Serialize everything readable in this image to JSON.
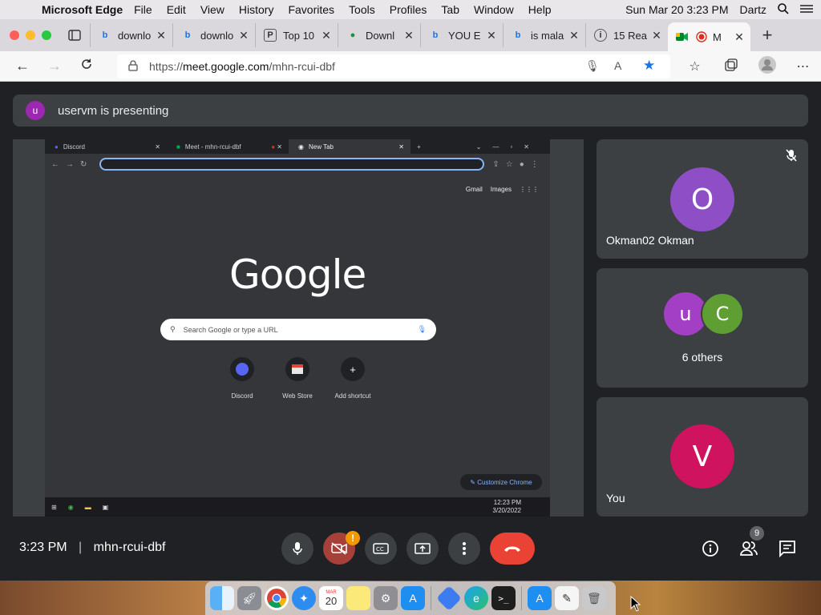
{
  "menubar": {
    "app_name": "Microsoft Edge",
    "menus": [
      "File",
      "Edit",
      "View",
      "History",
      "Favorites",
      "Tools",
      "Profiles",
      "Tab",
      "Window",
      "Help"
    ],
    "clock": "Sun Mar 20  3:23 PM",
    "user": "Dartz"
  },
  "tabs": [
    {
      "title": "downlo",
      "favicon": "bing-icon"
    },
    {
      "title": "downlo",
      "favicon": "bing-icon"
    },
    {
      "title": "Top 10",
      "favicon": "page-icon"
    },
    {
      "title": "Downl",
      "favicon": "download-site-icon"
    },
    {
      "title": "YOU E",
      "favicon": "bing-icon"
    },
    {
      "title": "is mala",
      "favicon": "bing-icon"
    },
    {
      "title": "15 Rea",
      "favicon": "page-icon"
    },
    {
      "title": "M",
      "favicon": "meet-icon",
      "active": true
    }
  ],
  "address": {
    "scheme": "https://",
    "host": "meet.google.com",
    "path": "/mhn-rcui-dbf"
  },
  "banner": {
    "avatar_letter": "u",
    "text": "uservm is presenting"
  },
  "shared_screen": {
    "tabs": [
      "Discord",
      "Meet - mhn-rcui-dbf",
      "New Tab"
    ],
    "links": [
      "Gmail",
      "Images"
    ],
    "logo": "Google",
    "search_placeholder": "Search Google or type a URL",
    "shortcuts": [
      "Discord",
      "Web Store",
      "Add shortcut"
    ],
    "customize": "Customize Chrome",
    "taskbar_time": "12:23 PM",
    "taskbar_date": "3/20/2022"
  },
  "participants": [
    {
      "letter": "O",
      "name": "Okman02 Okman",
      "color": "#8e4ec6",
      "muted": true
    },
    {
      "letters": [
        "u",
        "C"
      ],
      "name": "6 others",
      "colors": [
        "#a23fc4",
        "#5f9e33"
      ]
    },
    {
      "letter": "V",
      "name": "You",
      "color": "#d0135f"
    }
  ],
  "controls": {
    "time": "3:23 PM",
    "separator": "|",
    "meeting_code": "mhn-rcui-dbf",
    "camera_alert": "!",
    "people_count": "9"
  },
  "dock": [
    "finder-icon",
    "launchpad-icon",
    "chrome-icon",
    "safari-icon",
    "calendar-icon",
    "notes-icon",
    "system-preferences-icon",
    "app-store-icon",
    "xcode-icon",
    "edge-icon",
    "terminal-icon",
    "app-store-icon",
    "textedit-icon",
    "trash-icon"
  ],
  "dock_calendar_day": "20"
}
